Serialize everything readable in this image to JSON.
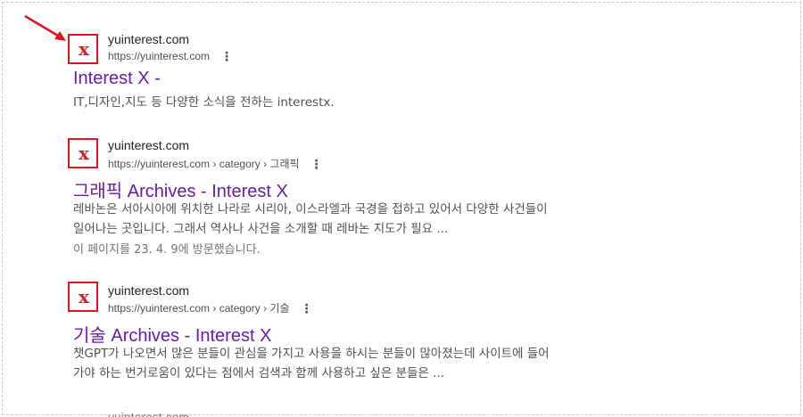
{
  "results": [
    {
      "site_name": "yuinterest.com",
      "url": "https://yuinterest.com",
      "title": "Interest X -",
      "snippet": [
        "IT,디자인,지도 등 다양한 소식을 전하는 interestx."
      ],
      "visited": ""
    },
    {
      "site_name": "yuinterest.com",
      "url": "https://yuinterest.com › category › 그래픽",
      "title": "그래픽 Archives - Interest X",
      "snippet": [
        "레바논은 서아시아에 위치한 나라로 시리아, 이스라엘과 국경을 접하고 있어서 다양한 사건들이",
        "일어나는 곳입니다. 그래서 역사나 사건을 소개할 때 레바논 지도가 필요 ..."
      ],
      "visited": "이 페이지를 23. 4. 9에 방문했습니다."
    },
    {
      "site_name": "yuinterest.com",
      "url": "https://yuinterest.com › category › 기술",
      "title": "기술 Archives - Interest X",
      "snippet": [
        "챗GPT가 나오면서 많은 분들이 관심을 가지고 사용을 하시는 분들이 많아졌는데 사이트에 들어",
        "가야 하는 번거로움이 있다는 점에서 검색과 함께 사용하고 싶은 분들은 ..."
      ],
      "visited": ""
    }
  ],
  "partial_result": {
    "site_name": "yuinterest.com"
  },
  "favicon_letter": "x",
  "more_icon": "⋮",
  "colors": {
    "highlight_box": "#e3141b",
    "arrow": "#e3141b",
    "title_link": "#681da8",
    "snippet": "#4d5156"
  }
}
